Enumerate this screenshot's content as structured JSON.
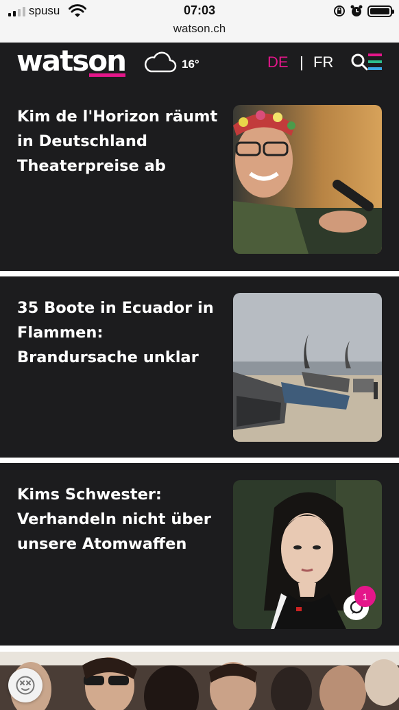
{
  "status_bar": {
    "carrier": "spusu",
    "time": "07:03",
    "url": "watson.ch"
  },
  "header": {
    "logo": "watson",
    "temperature": "16°",
    "weather_icon": "cloud-icon",
    "lang_active": "DE",
    "lang_separator": "|",
    "lang_other": "FR",
    "search_icon": "search-menu-icon"
  },
  "colors": {
    "brand_pink": "#e4168a",
    "header_bg": "#1c1c1e",
    "card_bg": "#1c1c1e",
    "divider": "#ffffff"
  },
  "articles": [
    {
      "title": "Kim de l'Horizon räumt in Deutschland Theaterpreise ab"
    },
    {
      "title": "35 Boote in Ecuador in Flammen: Brandursache unklar"
    },
    {
      "title": "Kims Schwester: Verhandeln nicht über unsere Atomwaffen",
      "comment_count": "1"
    }
  ],
  "floating": {
    "emoji_icon": "dizzy-face-icon"
  }
}
